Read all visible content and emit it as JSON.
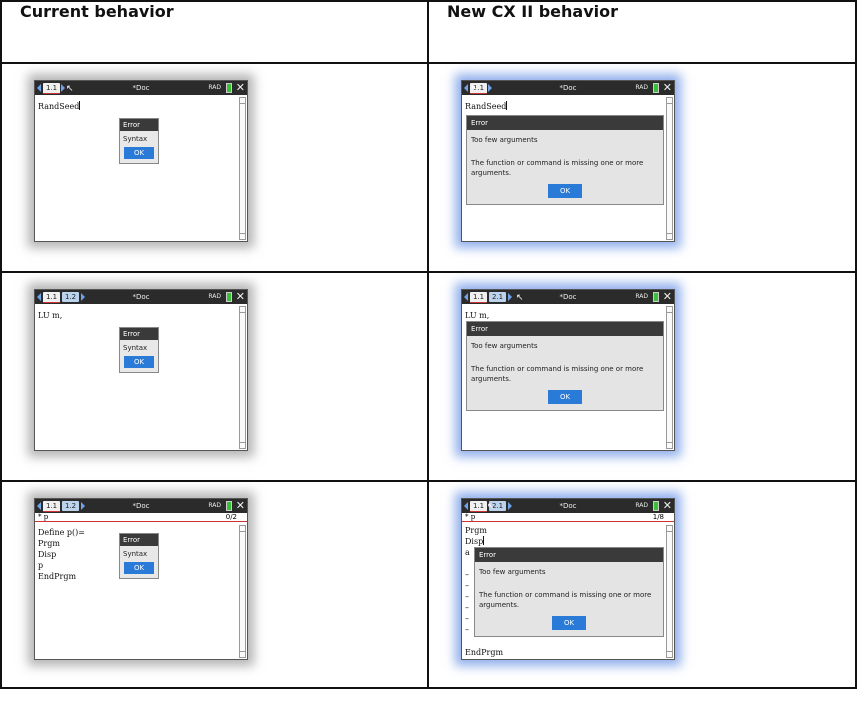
{
  "headers": {
    "current": "Current behavior",
    "new": "New CX II behavior"
  },
  "common": {
    "doc_title": "*Doc",
    "rad": "RAD",
    "close_glyph": "✕",
    "cursor_glyph": "↖",
    "error_title": "Error",
    "ok_label": "OK",
    "syntax_msg": "Syntax",
    "too_few_msg": "Too few arguments",
    "missing_msg_line1": "The function or command is missing one or more",
    "missing_msg_line2": "arguments.",
    "battery_color": "#3bbf3b",
    "accent_blue": "#2a7ad8"
  },
  "rows": [
    {
      "current": {
        "tabs": [
          "1.1"
        ],
        "content": "RandSeed"
      },
      "new": {
        "tabs": [
          "1.1"
        ],
        "content": "RandSeed"
      }
    },
    {
      "current": {
        "tabs": [
          "1.1",
          "1.2"
        ],
        "content": "LU m,"
      },
      "new": {
        "tabs": [
          "1.1",
          "2.1"
        ],
        "content": "LU m,"
      }
    },
    {
      "current": {
        "tabs": [
          "1.1",
          "1.2"
        ],
        "entry_label": "* p",
        "entry_count": "0/2",
        "lines": [
          "Define p()=",
          "Prgm",
          "Disp",
          "p",
          "EndPrgm"
        ]
      },
      "new": {
        "tabs": [
          "1.1",
          "2.1"
        ],
        "entry_label": "* p",
        "entry_count": "1/8",
        "lines": [
          "Prgm",
          "Disp",
          "a"
        ],
        "dashes": [
          "–",
          "–",
          "–",
          "–",
          "–",
          "–"
        ],
        "end_line": "EndPrgm"
      }
    }
  ]
}
